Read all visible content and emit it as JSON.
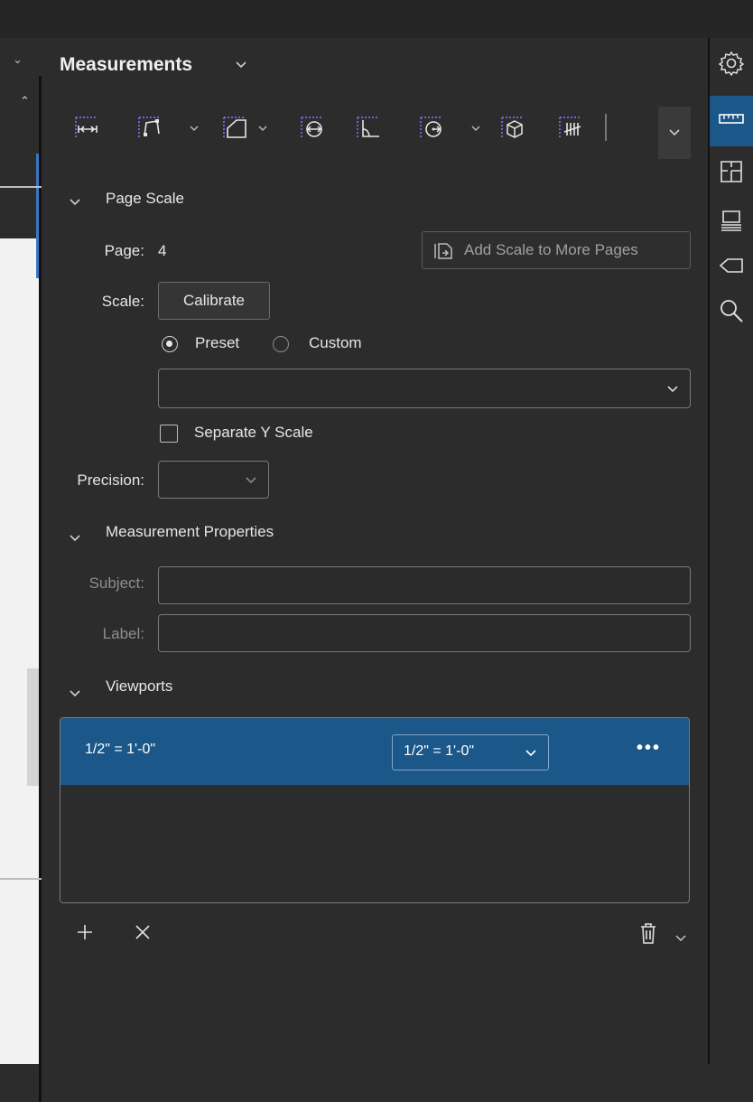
{
  "panel": {
    "title": "Measurements"
  },
  "page_scale": {
    "title": "Page Scale",
    "page_label": "Page:",
    "page_value": "4",
    "add_scale_button": "Add Scale to More Pages",
    "scale_label": "Scale:",
    "calibrate_button": "Calibrate",
    "preset_label": "Preset",
    "custom_label": "Custom",
    "preset_selected": true,
    "preset_value": "",
    "separate_y_label": "Separate Y Scale",
    "separate_y_checked": false,
    "precision_label": "Precision:",
    "precision_value": ""
  },
  "measurement_properties": {
    "title": "Measurement Properties",
    "subject_label": "Subject:",
    "subject_value": "",
    "label_label": "Label:",
    "label_value": ""
  },
  "viewports": {
    "title": "Viewports",
    "rows": [
      {
        "name": "1/2\" = 1'-0\"",
        "scale": "1/2\" = 1'-0\"",
        "more": "•••"
      }
    ]
  },
  "footer": {
    "add_icon": "plus-icon",
    "remove_icon": "close-icon",
    "delete_icon": "trash-icon"
  },
  "toolbar": {
    "tools": [
      "length-tool-icon",
      "polylength-tool-icon",
      "area-tool-icon",
      "diameter-tool-icon",
      "angle-tool-icon",
      "radius-tool-icon",
      "volume-tool-icon",
      "count-tool-icon"
    ]
  },
  "rail": {
    "icons": [
      "settings-icon",
      "measurements-icon",
      "spaces-icon",
      "markups-list-icon",
      "tags-icon",
      "search-icon"
    ],
    "active": "measurements-icon"
  },
  "colors": {
    "accent": "#1b5788",
    "tool_purple": "#7b5cd6",
    "panel_bg": "#2c2c2c"
  }
}
